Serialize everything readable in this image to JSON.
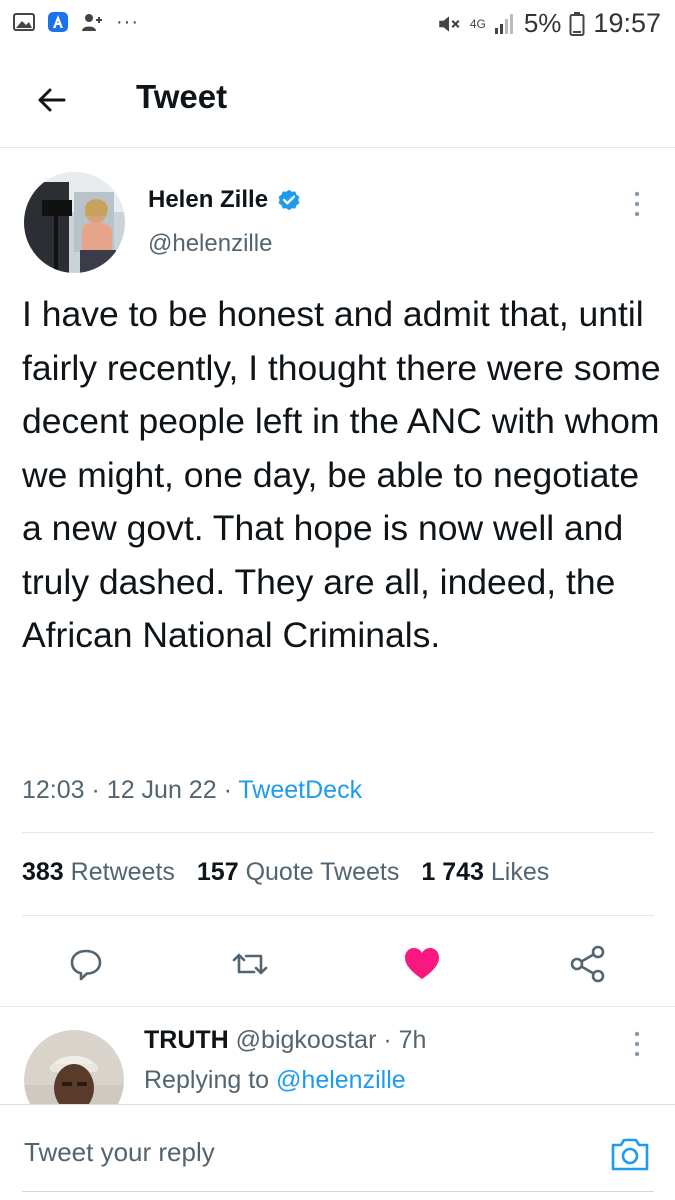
{
  "status_bar": {
    "net": "4G",
    "battery": "5%",
    "time": "19:57",
    "overflow": "···"
  },
  "header": {
    "title": "Tweet",
    "back_icon": "arrow-left-icon"
  },
  "tweet": {
    "author_name": "Helen Zille",
    "author_handle": "@helenzille",
    "text": "I have to be honest and admit that, until fairly recently, I thought there were some decent people left in the ANC with whom we might, one day, be able to negotiate a new govt. That hope is now well and truly dashed. They are all, indeed, the African National Criminals.",
    "time": "12:03",
    "date": "12 Jun 22",
    "source": "TweetDeck",
    "stats": {
      "retweets_count": "383",
      "retweets_label": "Retweets",
      "quotes_count": "157",
      "quotes_label": "Quote Tweets",
      "likes_count": "1 743",
      "likes_label": "Likes"
    },
    "liked": true
  },
  "reply": {
    "name": "TRUTH",
    "handle": "@bigkoostar",
    "age": "7h",
    "replying_prefix": "Replying to",
    "replying_to": "@helenzille"
  },
  "compose": {
    "placeholder": "Tweet your reply"
  },
  "colors": {
    "accent": "#1d9bf0",
    "like": "#f91880",
    "muted": "#536471",
    "text": "#0f1419"
  }
}
